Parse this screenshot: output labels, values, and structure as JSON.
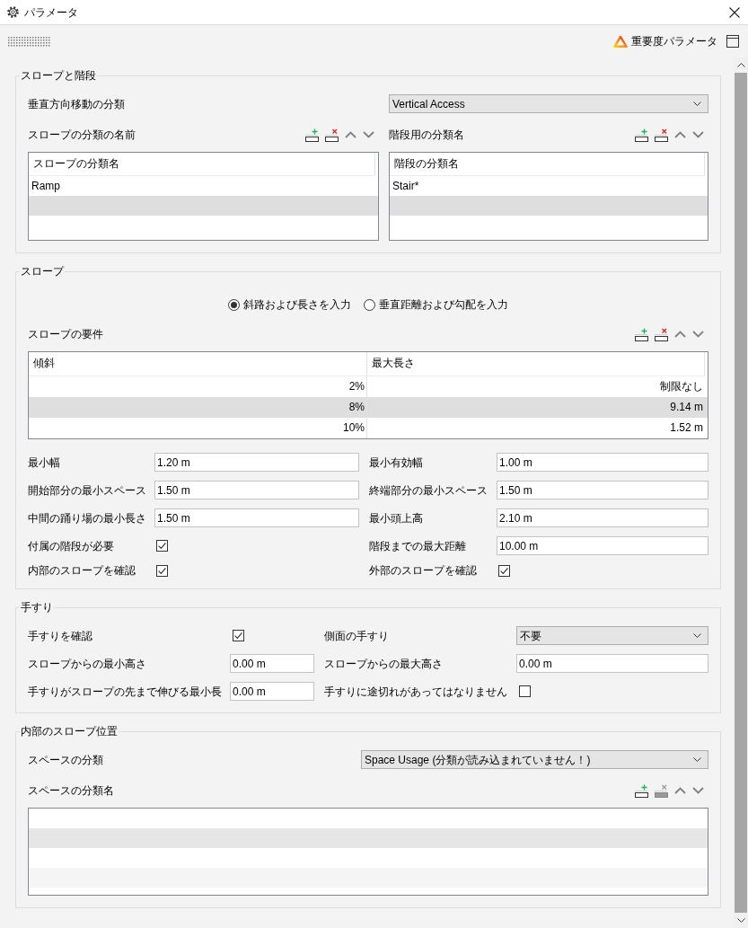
{
  "window": {
    "title": "パラメータ"
  },
  "toolbar": {
    "importance_button": "重要度パラメータ"
  },
  "sections": [
    {
      "kind": "slopes_stairs",
      "title": "スロープと階段",
      "blocks": [
        {
          "kind": "select_row",
          "label": "垂直方向移動の分類",
          "value": "Vertical Access"
        },
        {
          "kind": "list_pair",
          "lists": [
            {
              "label": "スロープの分類の名前",
              "column": "スロープの分類名",
              "items": [
                "Ramp"
              ],
              "tools": [
                {
                  "kind": "add",
                  "disabled": false
                },
                {
                  "kind": "delete",
                  "disabled": false
                },
                {
                  "kind": "move_up",
                  "disabled": false
                },
                {
                  "kind": "move_down",
                  "disabled": false
                }
              ]
            },
            {
              "label": "階段用の分類名",
              "column": "階段の分類名",
              "items": [
                "Stair*"
              ],
              "tools": [
                {
                  "kind": "add",
                  "disabled": false
                },
                {
                  "kind": "delete",
                  "disabled": false
                },
                {
                  "kind": "move_up",
                  "disabled": false
                },
                {
                  "kind": "move_down",
                  "disabled": false
                }
              ]
            }
          ]
        }
      ]
    },
    {
      "kind": "slope",
      "title": "スロープ",
      "blocks": [
        {
          "kind": "radio_group",
          "options": [
            {
              "label": "斜路および長さを入力",
              "selected": true
            },
            {
              "label": "垂直距離および勾配を入力",
              "selected": false
            }
          ]
        },
        {
          "kind": "table",
          "label": "スロープの要件",
          "tools": [
            {
              "kind": "add",
              "disabled": false
            },
            {
              "kind": "delete",
              "disabled": false
            },
            {
              "kind": "move_up",
              "disabled": false
            },
            {
              "kind": "move_down",
              "disabled": false
            }
          ],
          "columns": [
            "傾斜",
            "最大長さ"
          ],
          "rows": [
            [
              "2%",
              "制限なし"
            ],
            [
              "8%",
              "9.14 m"
            ],
            [
              "10%",
              "1.52 m"
            ]
          ]
        },
        {
          "kind": "form_grid",
          "rows": [
            [
              {
                "kind": "text",
                "label": "最小幅",
                "value": "1.20 m"
              },
              {
                "kind": "text",
                "label": "最小有効幅",
                "value": "1.00 m"
              }
            ],
            [
              {
                "kind": "text",
                "label": "開始部分の最小スペース",
                "value": "1.50 m"
              },
              {
                "kind": "text",
                "label": "終端部分の最小スペース",
                "value": "1.50 m"
              }
            ],
            [
              {
                "kind": "text",
                "label": "中間の踊り場の最小長さ",
                "value": "1.50 m"
              },
              {
                "kind": "text",
                "label": "最小頭上高",
                "value": "2.10 m"
              }
            ],
            [
              {
                "kind": "checkbox",
                "label": "付属の階段が必要",
                "checked": true
              },
              {
                "kind": "text",
                "label": "階段までの最大距離",
                "value": "10.00 m"
              }
            ],
            [
              {
                "kind": "checkbox",
                "label": "内部のスロープを確認",
                "checked": true
              },
              {
                "kind": "checkbox",
                "label": "外部のスロープを確認",
                "checked": true
              }
            ]
          ]
        }
      ]
    },
    {
      "kind": "handrails",
      "title": "手すり",
      "blocks": [
        {
          "kind": "form_grid",
          "rows": [
            [
              {
                "kind": "checkbox",
                "label": "手すりを確認",
                "checked": true
              },
              {
                "kind": "select",
                "label": "側面の手すり",
                "value": "不要"
              }
            ],
            [
              {
                "kind": "text",
                "label": "スロープからの最小高さ",
                "value": "0.00 m"
              },
              {
                "kind": "text",
                "label": "スロープからの最大高さ",
                "value": "0.00 m"
              }
            ],
            [
              {
                "kind": "text",
                "label": "手すりがスロープの先まで伸びる最小長",
                "value": "0.00 m"
              },
              {
                "kind": "checkbox",
                "label": "手すりに途切れがあってはなりません",
                "checked": false
              }
            ]
          ]
        }
      ]
    },
    {
      "kind": "interior_location",
      "title": "内部のスロープ位置",
      "blocks": [
        {
          "kind": "select_row",
          "label": "スペースの分類",
          "value": "Space Usage (分類が読み込まれていません！)"
        },
        {
          "kind": "list",
          "label": "スペースの分類名",
          "tools": [
            {
              "kind": "add",
              "disabled": false
            },
            {
              "kind": "delete",
              "disabled": true
            },
            {
              "kind": "move_up",
              "disabled": false
            },
            {
              "kind": "move_down",
              "disabled": false
            }
          ]
        }
      ]
    }
  ]
}
